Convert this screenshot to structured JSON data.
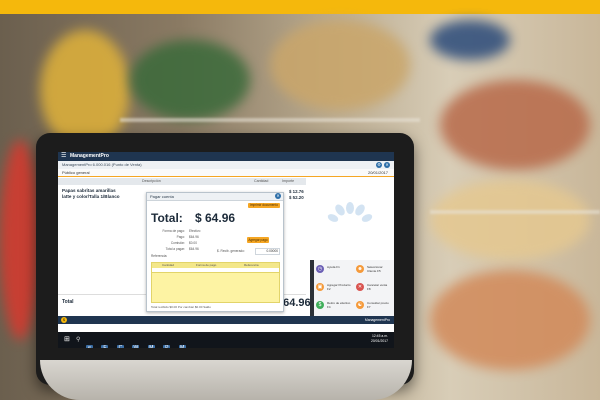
{
  "app": {
    "menu_icon": "hamburger-icon",
    "name": "ManagementPro",
    "window_title": "ManagementPro 6.000.016 (Punto de Venta)",
    "client": "Público general",
    "date": "20/01/2017"
  },
  "grid": {
    "headers": [
      "Descripción",
      "Cantidad",
      "Importe"
    ],
    "items": [
      {
        "description": "Papas sabritas amarillas",
        "price": "$ 12.76"
      },
      {
        "description": "latte y color/Talla 1/Blanco",
        "price": "$ 52.20"
      }
    ],
    "total_label": "Total",
    "total_amount": "$64.96"
  },
  "dialog": {
    "title": "Pagar cuenta",
    "top_button": "Imprimir documento",
    "total_label": "Total:",
    "total_amount": "$ 64.96",
    "fields": [
      {
        "label": "Forma de pago:",
        "value": "Efectivo"
      },
      {
        "label": "Pago:",
        "value": "$64.96"
      },
      {
        "label": "Comisión:",
        "value": "$0.00"
      },
      {
        "label": "Total a pagar:",
        "value": "$64.96"
      },
      {
        "label": "Referencia:",
        "value": ""
      }
    ],
    "add_button": "Agregar pago",
    "received_label": "$. Recib. generado:",
    "received_value": "0.00000",
    "table_headers": [
      "Cantidad",
      "Forma de pago",
      "Referencia"
    ],
    "footer": "Total recibido      $0.00   Por cambiar   $0.00   Saldo"
  },
  "tiles": [
    {
      "icon": "clock-icon",
      "label": "Ayuda F1",
      "color": "#6b5fb5"
    },
    {
      "icon": "person-icon",
      "label": "Seleccionar Cliente F5",
      "color": "#f59a3a"
    },
    {
      "icon": "box-icon",
      "label": "Agregar Producto F2",
      "color": "#f59a3a"
    },
    {
      "icon": "cancel-icon",
      "label": "Cancelar venta F8",
      "color": "#d9534f"
    },
    {
      "icon": "money-icon",
      "label": "Retiro de efectivo F4",
      "color": "#3fae5a"
    },
    {
      "icon": "cart-icon",
      "label": "Consultar precio F7",
      "color": "#f59a3a"
    }
  ],
  "footer": {
    "coin_icon": "coin-icon",
    "brand": "ManagementPro"
  },
  "taskbar": {
    "start_icon": "windows-icon",
    "search_icon": "search-icon",
    "apps": [
      "e",
      "F",
      "C",
      "W",
      "M",
      "P",
      "M"
    ],
    "time": "12:45 a.m.",
    "date": "20/01/2017"
  },
  "colors": {
    "accent": "#f5a623",
    "header": "#1f3550",
    "banner": "#f5b80c"
  }
}
